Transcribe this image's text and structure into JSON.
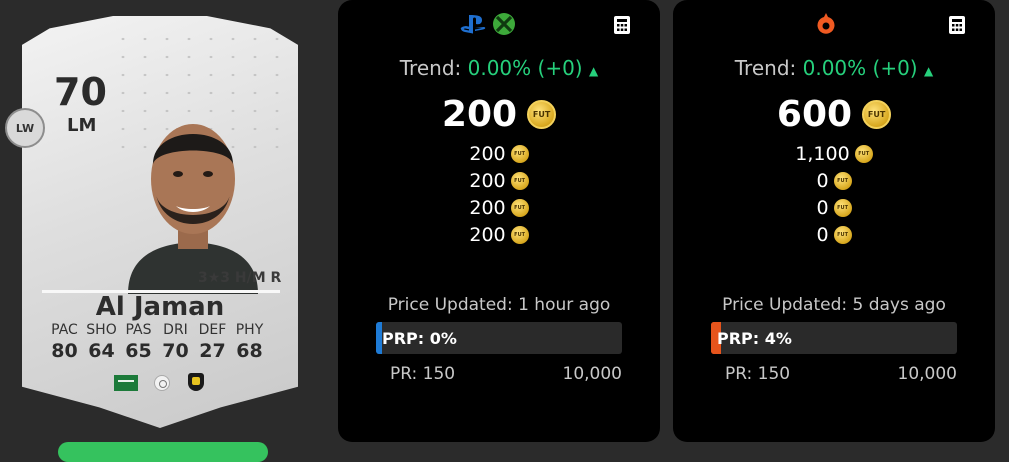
{
  "player": {
    "alt_position": "LW",
    "rating": "70",
    "position": "LM",
    "skills_workrates": "3★3 H/M R",
    "name": "Al Jaman",
    "stats": [
      {
        "label": "PAC",
        "value": "80"
      },
      {
        "label": "SHO",
        "value": "64"
      },
      {
        "label": "PAS",
        "value": "65"
      },
      {
        "label": "DRI",
        "value": "70"
      },
      {
        "label": "DEF",
        "value": "27"
      },
      {
        "label": "PHY",
        "value": "68"
      }
    ],
    "icons": {
      "nation": "saudi-arabia-flag",
      "league": "league-badge",
      "club": "club-badge"
    }
  },
  "panels": {
    "console": {
      "platform_icons": [
        "playstation-icon",
        "xbox-icon"
      ],
      "trend_label": "Trend:",
      "trend_value": "0.00% (+0)",
      "price": "200",
      "prices": [
        "200",
        "200",
        "200",
        "200"
      ],
      "updated": "Price Updated: 1 hour ago",
      "prp": "PRP: 0%",
      "prp_fraction": 0.0,
      "prp_color": "#1e7bd6",
      "pr_min": "PR: 150",
      "pr_max": "10,000"
    },
    "pc": {
      "platform_icons": [
        "origin-icon"
      ],
      "trend_label": "Trend:",
      "trend_value": "0.00% (+0)",
      "price": "600",
      "prices": [
        "1,100",
        "0",
        "0",
        "0"
      ],
      "updated": "Price Updated: 5 days ago",
      "prp": "PRP: 4%",
      "prp_fraction": 0.04,
      "prp_color": "#e6541c",
      "pr_min": "PR: 150",
      "pr_max": "10,000"
    }
  },
  "coin_label": "FUT",
  "colors": {
    "trend_up": "#26d07c",
    "coin": "#e0b030"
  }
}
